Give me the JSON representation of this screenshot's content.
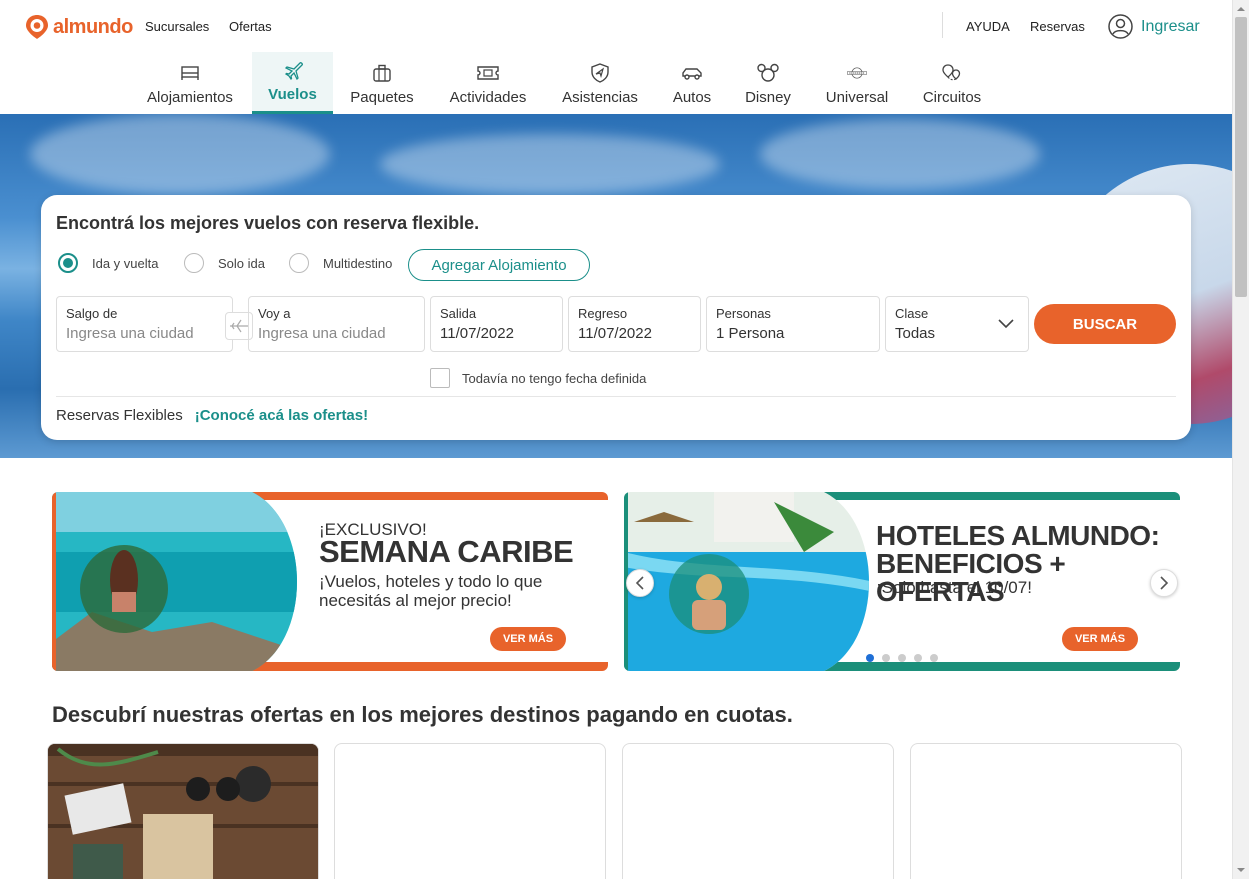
{
  "header": {
    "brand": "almundo",
    "links": [
      "Sucursales",
      "Ofertas"
    ],
    "help": "AYUDA",
    "reservas": "Reservas",
    "login": "Ingresar"
  },
  "nav": {
    "items": [
      {
        "label": "Alojamientos",
        "icon": "bed-icon"
      },
      {
        "label": "Vuelos",
        "icon": "plane-icon",
        "active": true
      },
      {
        "label": "Paquetes",
        "icon": "suitcase-icon"
      },
      {
        "label": "Actividades",
        "icon": "ticket-icon"
      },
      {
        "label": "Asistencias",
        "icon": "shield-icon"
      },
      {
        "label": "Autos",
        "icon": "car-icon"
      },
      {
        "label": "Disney",
        "icon": "mickey-icon"
      },
      {
        "label": "Universal",
        "icon": "universal-globe-icon"
      },
      {
        "label": "Circuitos",
        "icon": "map-pins-icon"
      }
    ]
  },
  "search": {
    "title": "Encontrá los mejores vuelos con reserva flexible.",
    "trip_types": [
      "Ida y vuelta",
      "Solo ida",
      "Multidestino"
    ],
    "selected_trip_type": "Ida y vuelta",
    "add_lodging": "Agregar Alojamiento",
    "origin": {
      "label": "Salgo de",
      "placeholder": "Ingresa una ciudad"
    },
    "destination": {
      "label": "Voy a",
      "placeholder": "Ingresa una ciudad"
    },
    "departure": {
      "label": "Salida",
      "value": "11/07/2022"
    },
    "return": {
      "label": "Regreso",
      "value": "11/07/2022"
    },
    "passengers": {
      "label": "Personas",
      "value": "1 Persona"
    },
    "cabin": {
      "label": "Clase",
      "value": "Todas"
    },
    "submit": "BUSCAR",
    "no_date": "Todavía no tengo fecha definida",
    "flexible_label": "Reservas Flexibles",
    "flexible_link": "¡Conocé acá las ofertas!"
  },
  "banners": [
    {
      "kicker": "¡EXCLUSIVO!",
      "headline": "SEMANA CARIBE",
      "sub": "¡Vuelos, hoteles y todo lo que necesitás al mejor precio!",
      "cta": "VER MÁS",
      "accent": "#e8632b"
    },
    {
      "kicker": "",
      "headline": "HOTELES ALMUNDO: BENEFICIOS + OFERTAS",
      "sub": "¡Solo hasta el 10/07!",
      "cta": "VER MÁS",
      "accent": "#1b8f7a"
    }
  ],
  "carousel": {
    "dots": 5,
    "active": 1
  },
  "offers": {
    "title": "Descubrí nuestras ofertas en los mejores destinos pagando en cuotas."
  },
  "colors": {
    "brand_orange": "#e8632b",
    "teal": "#1b8f8a"
  }
}
